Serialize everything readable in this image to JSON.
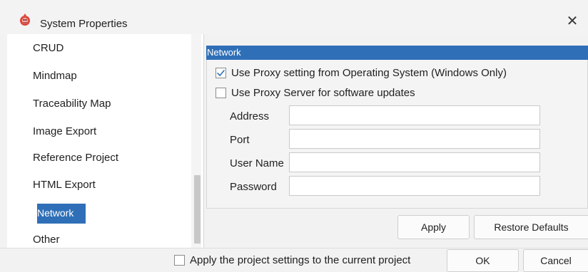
{
  "window": {
    "title": "System Properties",
    "icon": "app-logo-icon",
    "close_glyph": "✕"
  },
  "sidebar": {
    "items": [
      {
        "label": "CRUD",
        "selected": false
      },
      {
        "label": "Mindmap",
        "selected": false
      },
      {
        "label": "Traceability Map",
        "selected": false
      },
      {
        "label": "Image Export",
        "selected": false
      },
      {
        "label": "Reference Project",
        "selected": false
      },
      {
        "label": "HTML Export",
        "selected": false
      },
      {
        "label": "Network",
        "selected": true
      },
      {
        "label": "Other",
        "selected": false
      }
    ]
  },
  "panel": {
    "title": "Network",
    "use_os_proxy": {
      "label": "Use Proxy setting from Operating System (Windows Only)",
      "checked": true
    },
    "use_proxy_server": {
      "label": "Use Proxy Server for software updates",
      "checked": false
    },
    "fields": {
      "address": {
        "label": "Address",
        "value": ""
      },
      "port": {
        "label": "Port",
        "value": ""
      },
      "user_name": {
        "label": "User Name",
        "value": ""
      },
      "password": {
        "label": "Password",
        "value": ""
      }
    },
    "apply_label": "Apply",
    "restore_label": "Restore Defaults"
  },
  "footer": {
    "apply_project": {
      "label": "Apply the project settings to the current project",
      "checked": false
    },
    "ok_label": "OK",
    "cancel_label": "Cancel"
  },
  "colors": {
    "accent": "#2f6fb7",
    "window_bg": "#f2f2f2",
    "list_bg": "#ffffff"
  }
}
